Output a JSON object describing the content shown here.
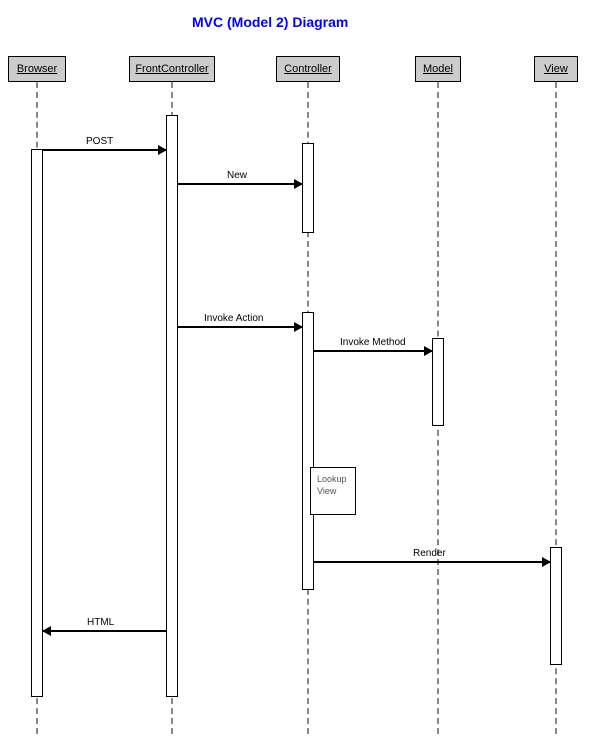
{
  "title": "MVC (Model 2) Diagram",
  "participants": {
    "browser": "Browser",
    "frontController": "FrontController",
    "controller": "Controller",
    "model": "Model",
    "view": "View"
  },
  "messages": {
    "post": "POST",
    "new": "New",
    "invokeAction": "Invoke Action",
    "invokeMethod": "Invoke Method",
    "render": "Render",
    "html": "HTML"
  },
  "notes": {
    "lookupView": "Lookup View"
  }
}
